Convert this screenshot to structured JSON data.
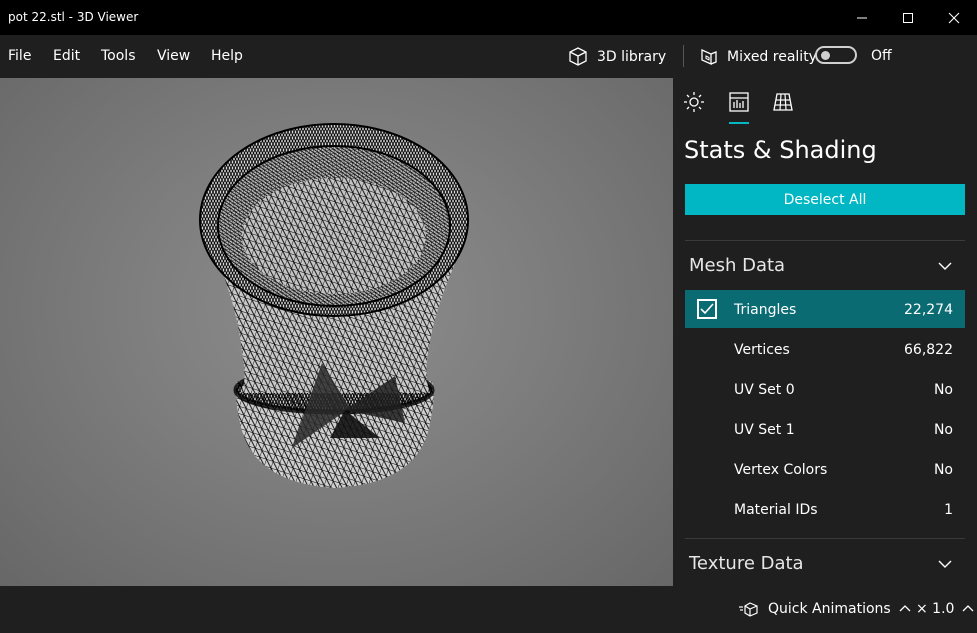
{
  "window": {
    "title": "pot 22.stl - 3D Viewer"
  },
  "menu": {
    "items": [
      "File",
      "Edit",
      "Tools",
      "View",
      "Help"
    ]
  },
  "toolbar": {
    "library_label": "3D library",
    "mixed_reality_label": "Mixed reality",
    "mixed_reality_state": "Off"
  },
  "panel": {
    "title": "Stats & Shading",
    "deselect_label": "Deselect All",
    "mesh_section": "Mesh Data",
    "mesh_rows": [
      {
        "label": "Triangles",
        "value": "22,274",
        "checked": true
      },
      {
        "label": "Vertices",
        "value": "66,822"
      },
      {
        "label": "UV Set 0",
        "value": "No"
      },
      {
        "label": "UV Set 1",
        "value": "No"
      },
      {
        "label": "Vertex Colors",
        "value": "No"
      },
      {
        "label": "Material IDs",
        "value": "1"
      }
    ],
    "texture_section": "Texture Data"
  },
  "status": {
    "animations_label": "Quick Animations",
    "speed_label": "× 1.0"
  },
  "colors": {
    "accent": "#00b7c3",
    "selected_row": "#0b6b73",
    "background": "#1f1f1f",
    "titlebar": "#000000"
  }
}
